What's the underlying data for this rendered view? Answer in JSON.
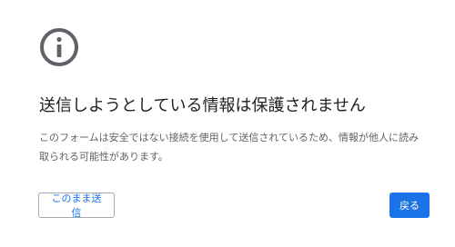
{
  "icon": {
    "name": "info-circle-icon",
    "color": "#5f6368"
  },
  "heading": "送信しようとしている情報は保護されません",
  "description": "このフォームは安全ではない接続を使用して送信されているため、情報が他人に読み取られる可能性があります。",
  "buttons": {
    "proceed_label": "このまま送信",
    "back_label": "戻る"
  },
  "colors": {
    "accent": "#1a73e8",
    "text": "#202124",
    "secondary_text": "#5f6368"
  }
}
